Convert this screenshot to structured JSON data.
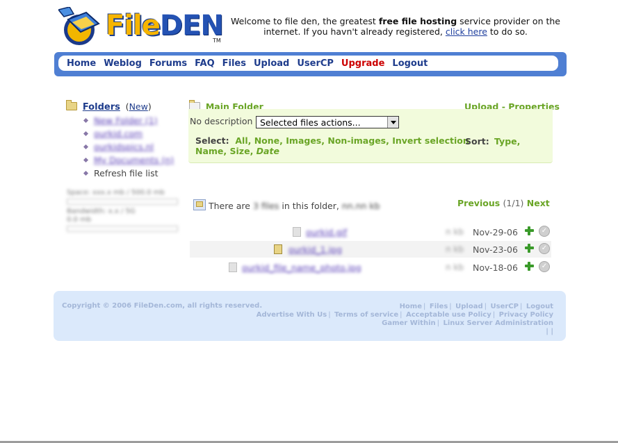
{
  "brand": {
    "logo_text_1": "File",
    "logo_text_2": "DEN",
    "tm": "TM"
  },
  "welcome": {
    "pre": "Welcome to file den, the greatest ",
    "bold": "free file hosting",
    "mid": " service provider on the internet. If you havn't already registered, ",
    "link": "click here",
    "post": " to do so."
  },
  "nav": [
    "Home",
    "Weblog",
    "Forums",
    "FAQ",
    "Files",
    "Upload",
    "UserCP",
    "Upgrade",
    "Logout"
  ],
  "sidebar": {
    "title": "Folders",
    "new_open": "(",
    "new_label": "New",
    "new_close": ")",
    "items": [
      {
        "label": "New Folder (1)"
      },
      {
        "label": "ourkid.com"
      },
      {
        "label": "ourkidspics.nl"
      },
      {
        "label": "My Documents (n)"
      },
      {
        "label": "Refresh file list"
      }
    ],
    "quota": {
      "line1": "Space: xxx.x mb / 500.0 mb",
      "line2": "Bandwidth: x.x / 5G",
      "line3": "0.0 mb"
    }
  },
  "main": {
    "folder_title": "Main Folder",
    "upload_label": "Upload",
    "dash": " - ",
    "properties_label": "Properties",
    "no_description": "No description",
    "select_value": "Selected files actions...",
    "select_label": "Select:",
    "select_options": [
      "All",
      "None",
      "Images",
      "Non-images",
      "Invert selection"
    ],
    "sort_label": "Sort:",
    "sort_options": [
      "Type",
      "Name",
      "Size",
      "Date"
    ],
    "there_are": "There are ",
    "file_count": "3 files",
    "in_folder": " in this folder, ",
    "total_size": "nn.nn kb",
    "pager": {
      "prev": "Previous",
      "mid": "(1/1)",
      "next": "Next"
    }
  },
  "files": [
    {
      "name": "ourkid.gif",
      "size": "n kb",
      "date": "Nov-29-06"
    },
    {
      "name": "ourkid_1.jpg",
      "size": "n kb",
      "date": "Nov-23-06"
    },
    {
      "name": "ourkid_file_name_photo.jpg",
      "size": "n kb",
      "date": "Nov-18-06"
    }
  ],
  "footer": {
    "copyright": "Copyright © 2006 FileDen.com, all rights reserved.",
    "line1": [
      "Home",
      "Files",
      "Upload",
      "UserCP",
      "Logout"
    ],
    "line2": [
      "Advertise With Us",
      "Terms of service",
      "Acceptable use Policy",
      "Privacy Policy"
    ],
    "line3": [
      "Gamer Within",
      "Linux Server Administration"
    ],
    "line4": "| |"
  },
  "colors": {
    "green": "#6aa526",
    "navy": "#1e3c8c",
    "red": "#cc0000",
    "nav_blue": "#4f7fd3",
    "panel": "#f2fbdc",
    "footer": "#dbe9fb"
  }
}
